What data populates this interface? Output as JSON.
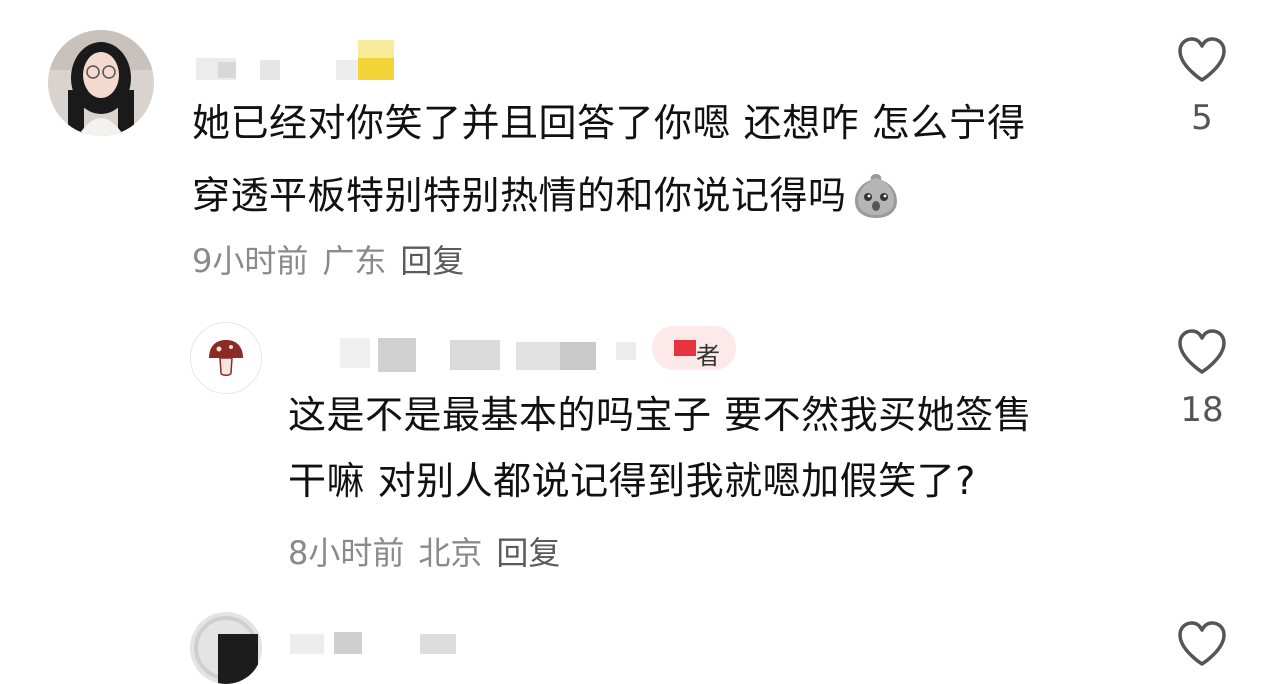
{
  "comments": [
    {
      "text_line1": "她已经对你笑了并且回答了你嗯 还想咋 怎么宁得",
      "text_line2": "穿透平板特别特别热情的和你说记得吗",
      "time": "9小时前",
      "location": "广东",
      "reply_label": "回复",
      "likes": "5"
    },
    {
      "badge": "者",
      "text_line1": "这是不是最基本的吗宝子 要不然我买她签售",
      "text_line2": "干嘛 对别人都说记得到我就嗯加假笑了?",
      "time": "8小时前",
      "location": "北京",
      "reply_label": "回复",
      "likes": "18"
    }
  ],
  "icons": {
    "like": "heart-outline-icon",
    "emoji": "sweat-blob-emoji-icon"
  },
  "colors": {
    "badge": "#e8343f",
    "meta": "#8a8a8a"
  }
}
